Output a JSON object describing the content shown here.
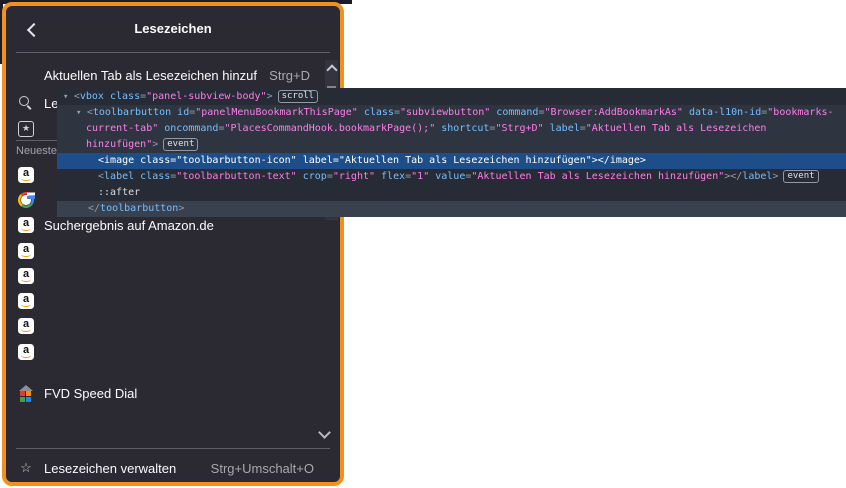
{
  "panel": {
    "highlight_border_color": "#f0901e",
    "background_color": "#2b2a33",
    "title": "Lesezeichen",
    "bookmark_current_tab": {
      "label": "Aktuellen Tab als Lesezeichen hinzufügen",
      "shortcut": "Strg+D"
    },
    "search_item": {
      "icon": "search",
      "label": "Lesezeichen durchsuchen"
    },
    "toolbar_item": {
      "icon": "star-frame",
      "label": ""
    },
    "section_label": "Neueste Lesezeichen",
    "bookmarks": [
      {
        "icon": "amazon",
        "label": ""
      },
      {
        "icon": "google",
        "label": ""
      },
      {
        "icon": "amazon",
        "label": "Suchergebnis auf Amazon.de"
      },
      {
        "icon": "amazon",
        "label": ""
      },
      {
        "icon": "amazon",
        "label": ""
      },
      {
        "icon": "amazon",
        "label": ""
      },
      {
        "icon": "amazon",
        "label": ""
      },
      {
        "icon": "amazon",
        "label": ""
      }
    ],
    "speed_dial_item": {
      "icon": "fvd-grid",
      "label": "FVD Speed Dial"
    },
    "manage_item": {
      "icon": "star",
      "label": "Lesezeichen verwalten",
      "shortcut": "Strg+Umschalt+O"
    }
  },
  "devtools": {
    "selection_color": "#1d4e89",
    "tag_color": "#75bfff",
    "value_color": "#ff7de9",
    "lines": [
      {
        "variant": "base",
        "ind": 0,
        "tokens": [
          {
            "c": "a",
            "s": "▾ "
          },
          {
            "c": "p",
            "s": "<"
          },
          {
            "c": "t",
            "s": "vbox"
          },
          {
            "c": "n",
            "s": " class"
          },
          {
            "c": "p",
            "s": "="
          },
          {
            "c": "v",
            "s": "\"panel-subview-body\""
          },
          {
            "c": "p",
            "s": ">"
          },
          {
            "c": "b",
            "s": "scroll"
          }
        ]
      },
      {
        "variant": "hover",
        "ind": 1,
        "tokens": [
          {
            "c": "a",
            "s": "▾ "
          },
          {
            "c": "p",
            "s": "<"
          },
          {
            "c": "t",
            "s": "toolbarbutton"
          },
          {
            "c": "n",
            "s": " id"
          },
          {
            "c": "p",
            "s": "="
          },
          {
            "c": "v",
            "s": "\"panelMenuBookmarkThisPage\""
          },
          {
            "c": "n",
            "s": " class"
          },
          {
            "c": "p",
            "s": "="
          },
          {
            "c": "v",
            "s": "\"subviewbutton\""
          },
          {
            "c": "n",
            "s": " command"
          },
          {
            "c": "p",
            "s": "="
          },
          {
            "c": "v",
            "s": "\"Browser:AddBookmarkAs\""
          },
          {
            "c": "n",
            "s": " data-l10n-id"
          },
          {
            "c": "p",
            "s": "="
          },
          {
            "c": "v",
            "s": "\"bookmarks-"
          }
        ]
      },
      {
        "variant": "hover",
        "ind": 2,
        "tokens": [
          {
            "c": "v",
            "s": "current-tab\""
          },
          {
            "c": "n",
            "s": " oncommand"
          },
          {
            "c": "p",
            "s": "="
          },
          {
            "c": "v",
            "s": "\"PlacesCommandHook.bookmarkPage();\""
          },
          {
            "c": "n",
            "s": " shortcut"
          },
          {
            "c": "p",
            "s": "="
          },
          {
            "c": "v",
            "s": "\"Strg+D\""
          },
          {
            "c": "n",
            "s": " label"
          },
          {
            "c": "p",
            "s": "="
          },
          {
            "c": "v",
            "s": "\"Aktuellen Tab als Lesezeichen"
          }
        ]
      },
      {
        "variant": "hover",
        "ind": 2,
        "tokens": [
          {
            "c": "v",
            "s": "hinzufügen\""
          },
          {
            "c": "p",
            "s": ">"
          },
          {
            "c": "b",
            "s": "event"
          }
        ]
      },
      {
        "variant": "selected",
        "ind": 3,
        "tokens": [
          {
            "c": "p",
            "s": "<"
          },
          {
            "c": "t",
            "s": "image"
          },
          {
            "c": "n",
            "s": " class"
          },
          {
            "c": "p",
            "s": "="
          },
          {
            "c": "v",
            "s": "\"toolbarbutton-icon\""
          },
          {
            "c": "n",
            "s": " label"
          },
          {
            "c": "p",
            "s": "="
          },
          {
            "c": "v",
            "s": "\"Aktuellen Tab als Lesezeichen hinzufügen\""
          },
          {
            "c": "p",
            "s": "></"
          },
          {
            "c": "t",
            "s": "image"
          },
          {
            "c": "p",
            "s": ">"
          }
        ]
      },
      {
        "variant": "base",
        "ind": 3,
        "tokens": [
          {
            "c": "p",
            "s": "<"
          },
          {
            "c": "t",
            "s": "label"
          },
          {
            "c": "n",
            "s": " class"
          },
          {
            "c": "p",
            "s": "="
          },
          {
            "c": "v",
            "s": "\"toolbarbutton-text\""
          },
          {
            "c": "n",
            "s": " crop"
          },
          {
            "c": "p",
            "s": "="
          },
          {
            "c": "v",
            "s": "\"right\""
          },
          {
            "c": "n",
            "s": " flex"
          },
          {
            "c": "p",
            "s": "="
          },
          {
            "c": "v",
            "s": "\"1\""
          },
          {
            "c": "n",
            "s": " value"
          },
          {
            "c": "p",
            "s": "="
          },
          {
            "c": "v",
            "s": "\"Aktuellen Tab als Lesezeichen hinzufügen\""
          },
          {
            "c": "p",
            "s": "></"
          },
          {
            "c": "t",
            "s": "label"
          },
          {
            "c": "p",
            "s": ">"
          },
          {
            "c": "b",
            "s": "event"
          }
        ]
      },
      {
        "variant": "base",
        "ind": 3,
        "tokens": [
          {
            "c": "w",
            "s": "::after"
          }
        ]
      },
      {
        "variant": "closing",
        "ind": 4,
        "tokens": [
          {
            "c": "p",
            "s": "</"
          },
          {
            "c": "t",
            "s": "toolbarbutton"
          },
          {
            "c": "p",
            "s": ">"
          }
        ]
      }
    ]
  }
}
